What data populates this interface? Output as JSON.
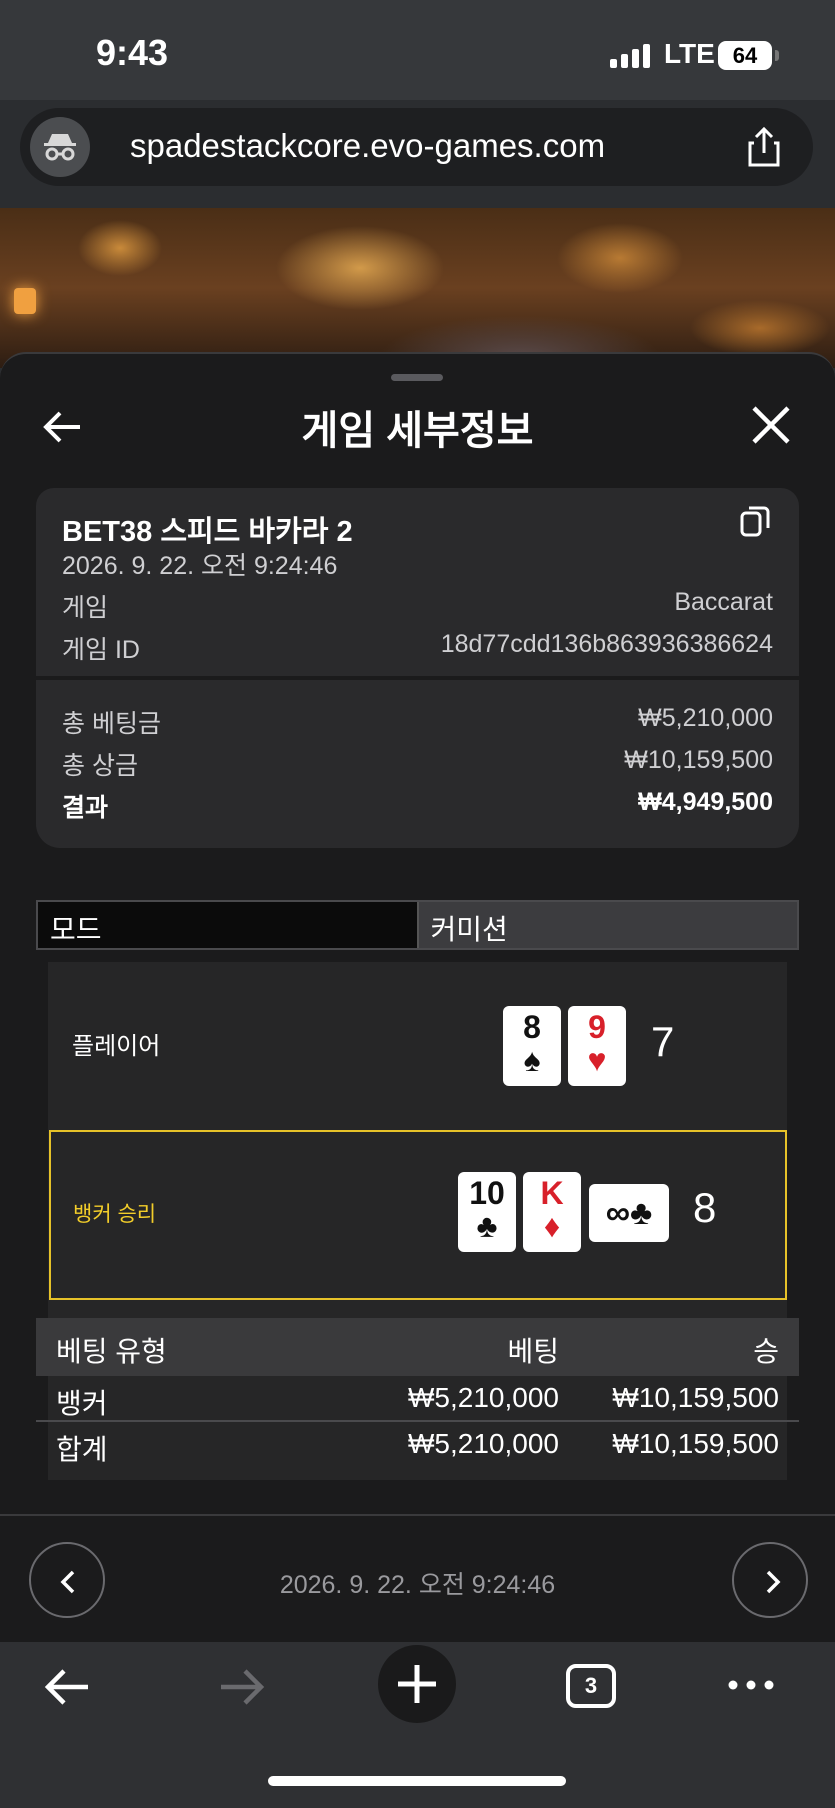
{
  "status_bar": {
    "time": "9:43",
    "network": "LTE",
    "battery": "64"
  },
  "browser": {
    "url": "spadestackcore.evo-games.com"
  },
  "sheet": {
    "title": "게임 세부정보",
    "game_name": "BET38 스피드 바카라 2",
    "datetime": "2026. 9. 22. 오전 9:24:46",
    "details": [
      {
        "label": "게임",
        "value": "Baccarat"
      },
      {
        "label": "게임 ID",
        "value": "18d77cdd136b863936386624"
      }
    ],
    "summary": [
      {
        "label": "총 베팅금",
        "value": "₩5,210,000"
      },
      {
        "label": "총 상금",
        "value": "₩10,159,500"
      },
      {
        "label": "결과",
        "value": "₩4,949,500"
      }
    ],
    "mode_tabs": [
      "모드",
      "커미션"
    ],
    "player": {
      "label": "플레이어",
      "total": "7",
      "cards": [
        {
          "rank": "8",
          "suit": "♠",
          "color": "#111111"
        },
        {
          "rank": "9",
          "suit": "♥",
          "color": "#d8202a"
        }
      ]
    },
    "banker": {
      "label": "뱅커 승리",
      "total": "8",
      "cards": [
        {
          "rank": "10",
          "suit": "♣",
          "color": "#111111"
        },
        {
          "rank": "K",
          "suit": "♦",
          "color": "#d8202a"
        }
      ],
      "third_card": {
        "rank": "∞",
        "suit": "♣"
      }
    },
    "bet_table": {
      "headers": [
        "베팅 유형",
        "베팅",
        "승"
      ],
      "rows": [
        [
          "뱅커",
          "₩5,210,000",
          "₩10,159,500"
        ],
        [
          "합계",
          "₩5,210,000",
          "₩10,159,500"
        ]
      ]
    },
    "footer_datetime": "2026. 9. 22. 오전 9:24:46"
  },
  "toolbar": {
    "tab_count": "3"
  },
  "colors": {
    "winner_border": "#e6c229",
    "winner_text": "#f2cd2a",
    "card_red": "#d8202a"
  }
}
